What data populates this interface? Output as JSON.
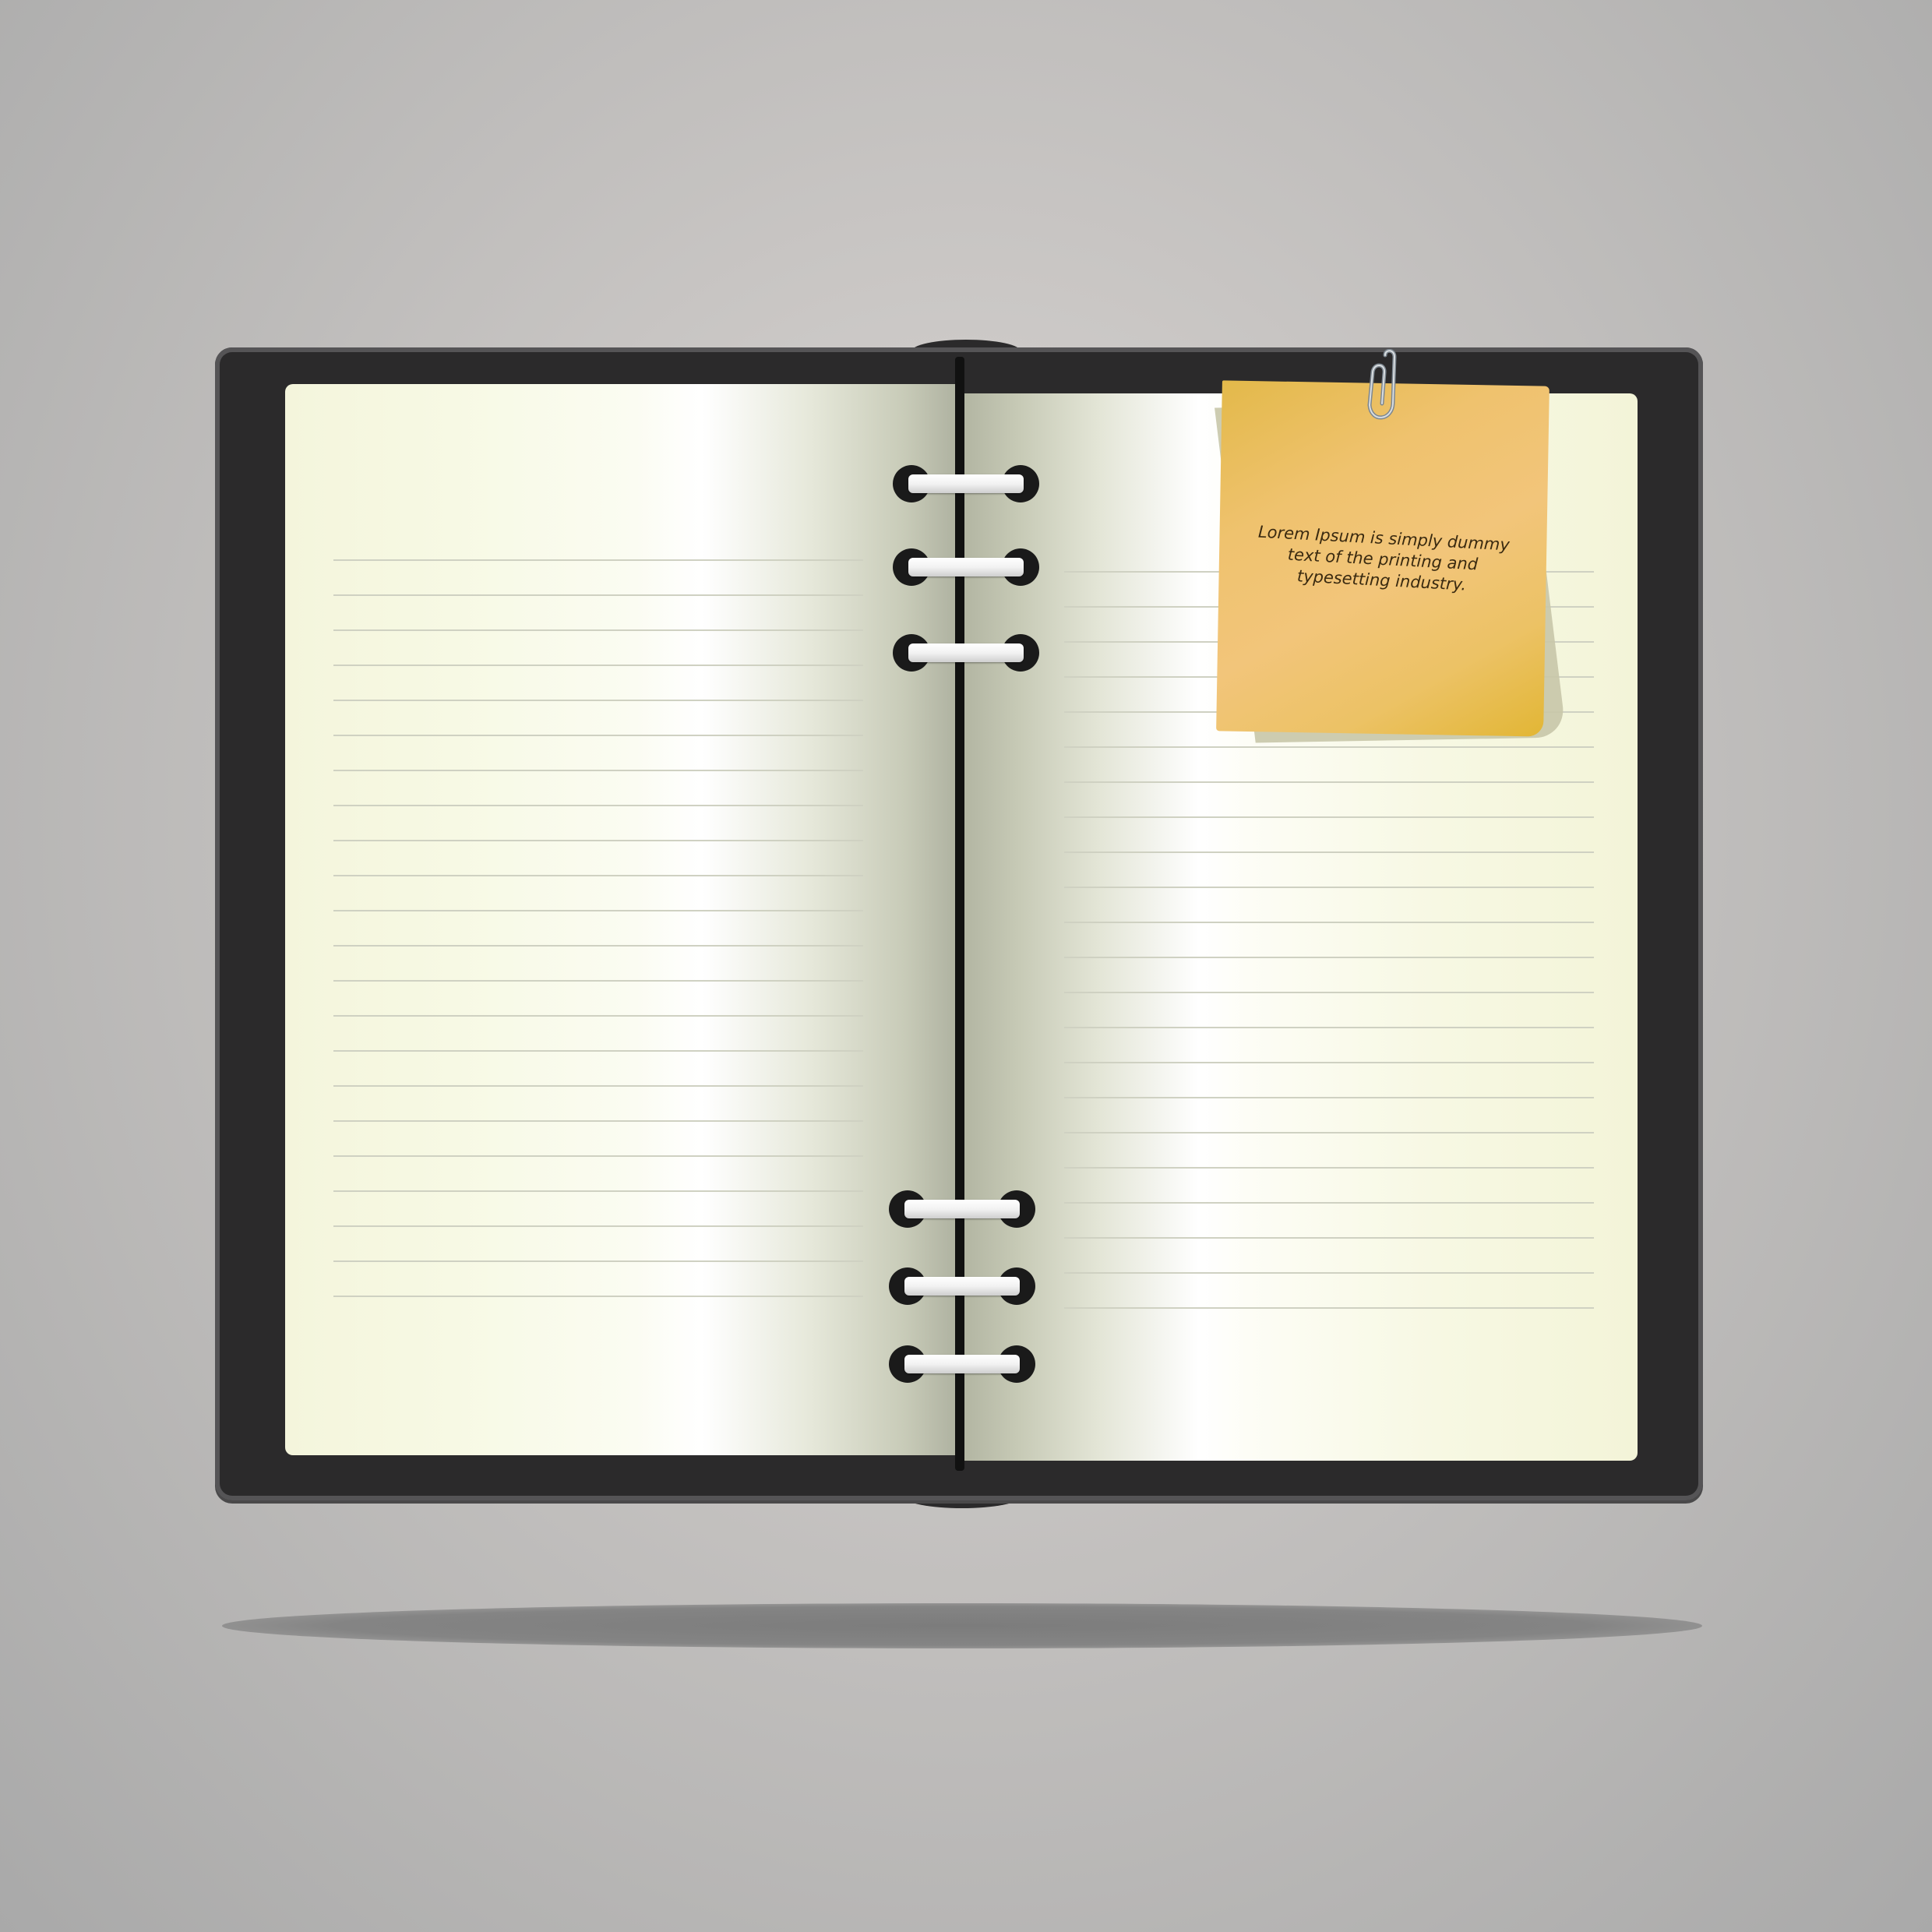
{
  "note": {
    "text": "Lorem Ipsum is simply dummy text of the printing and typesetting industry."
  },
  "colors": {
    "background": "#c9c6c4",
    "cover": "#2b2a2b",
    "page": "#f7f9e4",
    "note": "#efc26e",
    "tab_green": "#7dc242",
    "tab_pink": "#d9127a",
    "tab_blue": "#4d90d0"
  },
  "icons": {
    "paperclip": "paperclip-icon"
  }
}
